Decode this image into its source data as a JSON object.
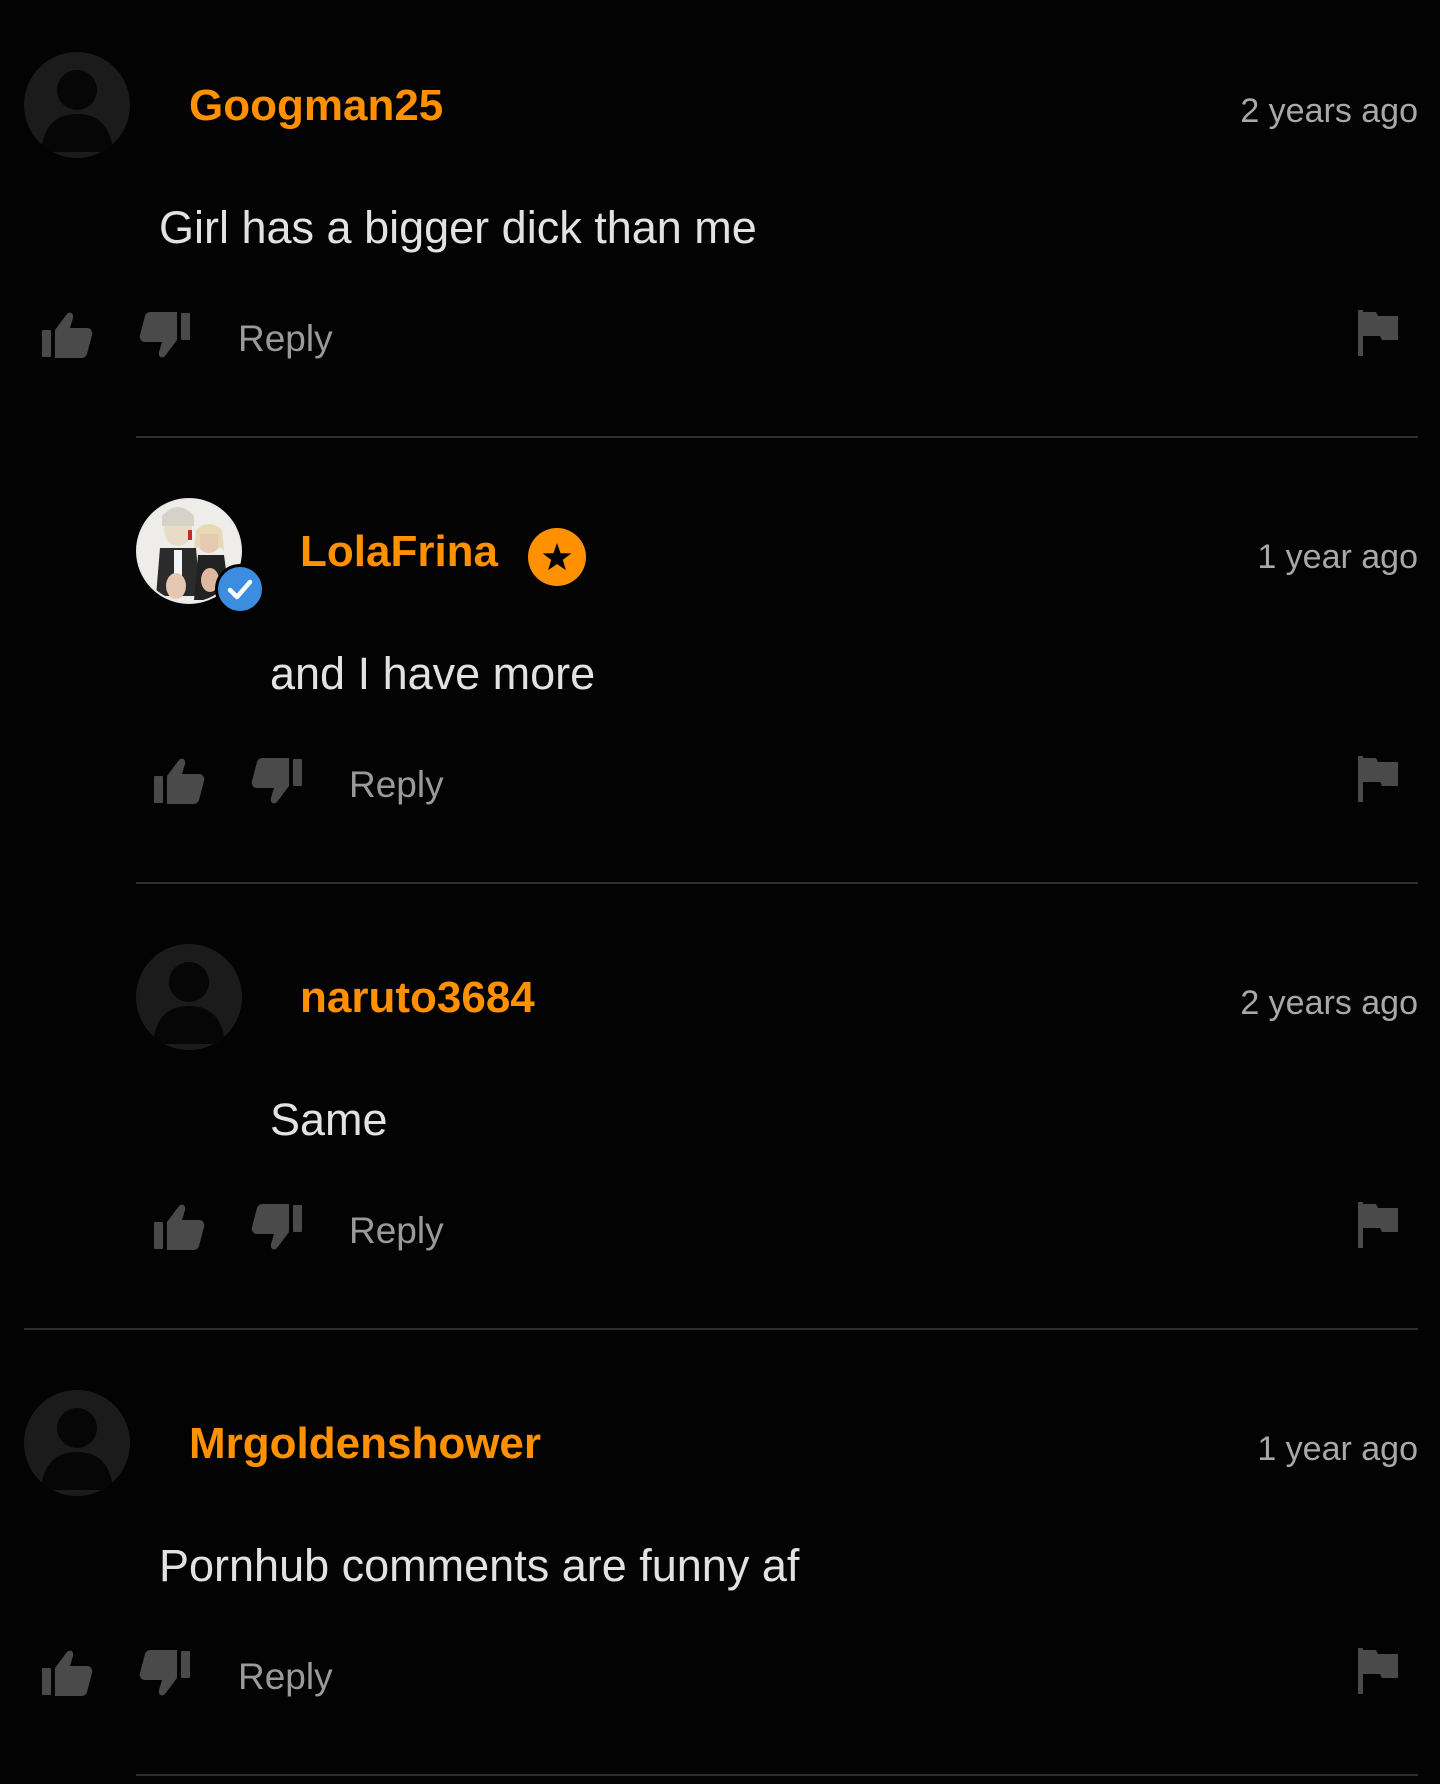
{
  "comments": [
    {
      "username": "Googman25",
      "time": "2 years ago",
      "text": "Girl has a bigger dick than me",
      "reply_label": "Reply",
      "avatar": "default-silhouette",
      "nested": false
    },
    {
      "username": "LolaFrina",
      "time": "1 year ago",
      "text": "and I have more",
      "reply_label": "Reply",
      "avatar": "profile-photo",
      "verified": true,
      "badge": "star",
      "nested": true
    },
    {
      "username": "naruto3684",
      "time": "2 years ago",
      "text": "Same",
      "reply_label": "Reply",
      "avatar": "default-silhouette",
      "nested": true
    },
    {
      "username": "Mrgoldenshower",
      "time": "1 year ago",
      "text": "Pornhub comments are funny af",
      "reply_label": "Reply",
      "avatar": "default-silhouette",
      "nested": false
    }
  ],
  "colors": {
    "background": "#030303",
    "username": "#ff9000",
    "verified": "#3c8de0",
    "icon": "#4a4a4a",
    "divider": "#2e2e2e"
  },
  "icons": {
    "like": "thumbs-up-icon",
    "dislike": "thumbs-down-icon",
    "report": "flag-icon",
    "verified": "check-icon",
    "badge": "star-icon"
  }
}
